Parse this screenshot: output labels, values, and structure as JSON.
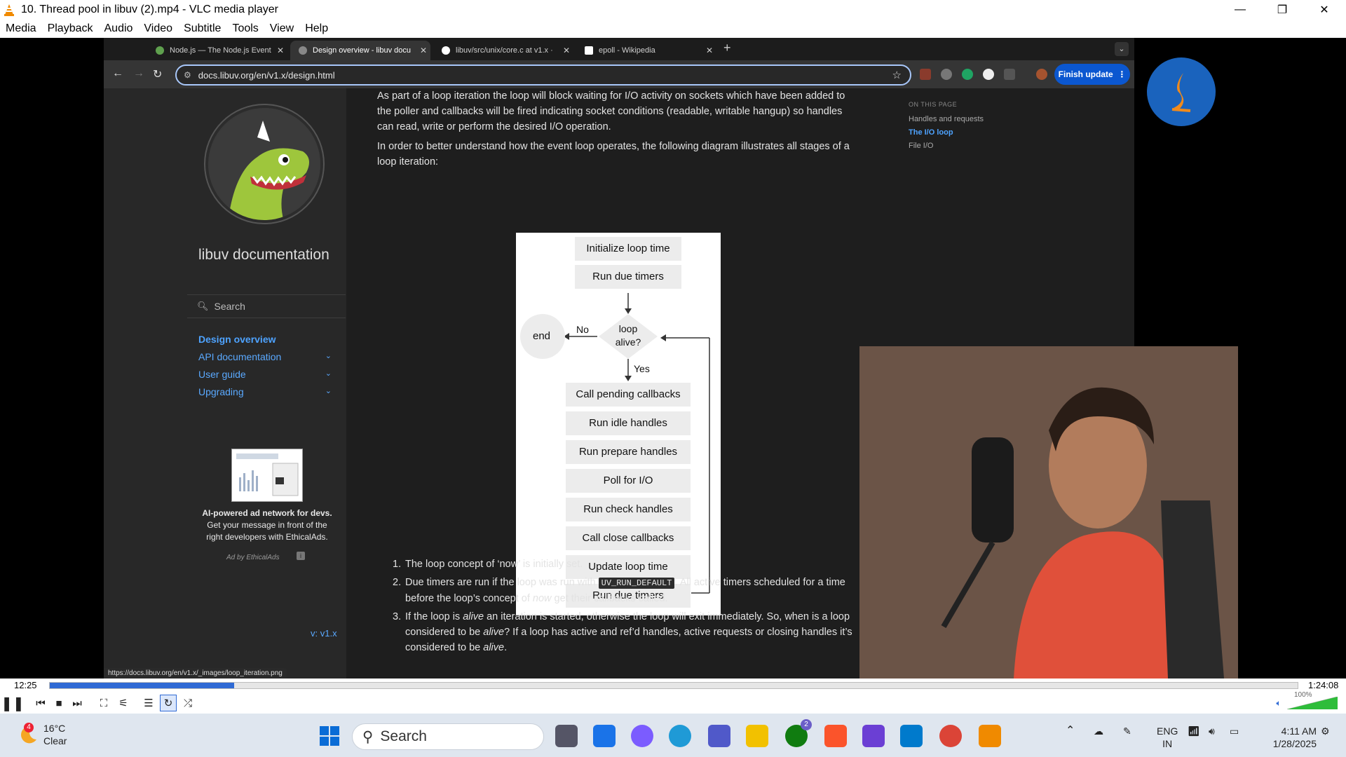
{
  "vlc": {
    "title": "10. Thread pool in libuv (2).mp4 - VLC media player",
    "menu": [
      "Media",
      "Playback",
      "Audio",
      "Video",
      "Subtitle",
      "Tools",
      "View",
      "Help"
    ],
    "elapsed": "12:25",
    "total": "1:24:08",
    "progress": 0.148,
    "volume_label": "100%",
    "volume": 1.0
  },
  "browser": {
    "tabs": [
      {
        "title": "Node.js — The Node.js Event",
        "color": "#5fa04e",
        "active": false
      },
      {
        "title": "Design overview - libuv docu",
        "color": "#888888",
        "active": true
      },
      {
        "title": "libuv/src/unix/core.c at v1.x ·",
        "color": "#ffffff",
        "active": false
      },
      {
        "title": "epoll - Wikipedia",
        "color": "#ffffff",
        "active": false
      }
    ],
    "url": "docs.libuv.org/en/v1.x/design.html",
    "finish_update": "Finish update",
    "status_url": "https://docs.libuv.org/en/v1.x/_images/loop_iteration.png"
  },
  "sidebar": {
    "title": "libuv documentation",
    "search_placeholder": "Search",
    "nav": [
      {
        "label": "Design overview",
        "current": true
      },
      {
        "label": "API documentation",
        "current": false
      },
      {
        "label": "User guide",
        "current": false
      },
      {
        "label": "Upgrading",
        "current": false
      }
    ],
    "ad_bold": "AI-powered ad network for devs.",
    "ad_rest": " Get your message in front of the right developers with EthicalAds.",
    "ad_by": "Ad by EthicalAds",
    "version": "v: v1.x"
  },
  "content": {
    "p1": "As part of a loop iteration the loop will block waiting for I/O activity on sockets which have been added to the poller and callbacks will be fired indicating socket conditions (readable, writable hangup) so handles can read, write or perform the desired I/O operation.",
    "p2": "In order to better understand how the event loop operates, the following diagram illustrates all stages of a loop iteration:",
    "diagram": {
      "init": "Initialize loop time",
      "timers1": "Run due timers",
      "decision_line1": "loop",
      "decision_line2": "alive?",
      "no": "No",
      "yes": "Yes",
      "end": "end",
      "stages": [
        "Call pending callbacks",
        "Run idle handles",
        "Run prepare handles",
        "Poll for I/O",
        "Run check handles",
        "Call close callbacks",
        "Update loop time",
        "Run due timers"
      ]
    },
    "list": {
      "i1": "The loop concept of ‘now’ is initially set.",
      "i2_a": "Due timers are run if the loop was run with ",
      "i2_code": "UV_RUN_DEFAULT",
      "i2_b": ". All active timers scheduled for a time before the loop’s concept of ",
      "i2_em": "now",
      "i2_c": " get their callbacks called.",
      "i3_a": "If the loop is ",
      "i3_em1": "alive",
      "i3_b": " an iteration is started, otherwise the loop will exit immediately. So, when is a loop considered to be ",
      "i3_em2": "alive",
      "i3_c": "? If a loop has active and ref’d handles, active requests or closing handles it’s considered to be ",
      "i3_em3": "alive",
      "i3_d": "."
    }
  },
  "toc": {
    "header": "ON THIS PAGE",
    "items": [
      {
        "label": "Handles and requests",
        "current": false
      },
      {
        "label": "The I/O loop",
        "current": true
      },
      {
        "label": "File I/O",
        "current": false
      }
    ]
  },
  "taskbar": {
    "weather_temp": "16°C",
    "weather_desc": "Clear",
    "weather_badge": "4",
    "search": "Search",
    "lang1": "ENG",
    "lang2": "IN",
    "time": "4:11 AM",
    "date": "1/28/2025",
    "badge": "2"
  }
}
